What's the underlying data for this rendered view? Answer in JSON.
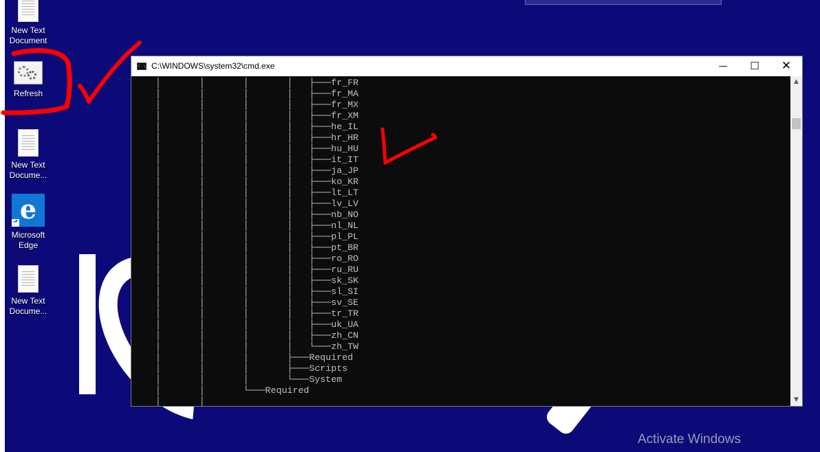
{
  "desktop": {
    "icons": [
      {
        "label": "New Text\nDocument",
        "icon": "text-document-icon"
      },
      {
        "label": "Refresh",
        "icon": "settings-gears-icon"
      },
      {
        "label": "New Text\nDocume...",
        "icon": "text-document-icon"
      },
      {
        "label": "Microsoft\nEdge",
        "icon": "edge-icon"
      },
      {
        "label": "New Text\nDocume...",
        "icon": "text-document-icon"
      }
    ],
    "edge_glyph": "e",
    "edge_shortcut_glyph": "⬏",
    "watermark": "Activate Windows",
    "background_color": "#0c0a78"
  },
  "cmd_window": {
    "title": "C:\\WINDOWS\\system32\\cmd.exe",
    "icon_text": "C:\\",
    "controls": {
      "minimize": "—",
      "maximize": "☐",
      "close": "✕"
    },
    "scroll_up": "▲",
    "scroll_down": "▼",
    "output": "    │       │       │       │   ├───fr_FR\n    │       │       │       │   ├───fr_MA\n    │       │       │       │   ├───fr_MX\n    │       │       │       │   ├───fr_XM\n    │       │       │       │   ├───he_IL\n    │       │       │       │   ├───hr_HR\n    │       │       │       │   ├───hu_HU\n    │       │       │       │   ├───it_IT\n    │       │       │       │   ├───ja_JP\n    │       │       │       │   ├───ko_KR\n    │       │       │       │   ├───lt_LT\n    │       │       │       │   ├───lv_LV\n    │       │       │       │   ├───nb_NO\n    │       │       │       │   ├───nl_NL\n    │       │       │       │   ├───pl_PL\n    │       │       │       │   ├───pt_BR\n    │       │       │       │   ├───ro_RO\n    │       │       │       │   ├───ru_RU\n    │       │       │       │   ├───sk_SK\n    │       │       │       │   ├───sl_SI\n    │       │       │       │   ├───sv_SE\n    │       │       │       │   ├───tr_TR\n    │       │       │       │   ├───uk_UA\n    │       │       │       │   ├───zh_CN\n    │       │       │       │   └───zh_TW\n    │       │       │       ├───Required\n    │       │       │       ├───Scripts\n    │       │       │       └───System\n    │       │       └───Required\n    │       │"
  },
  "annotation_color": "#ff0000"
}
